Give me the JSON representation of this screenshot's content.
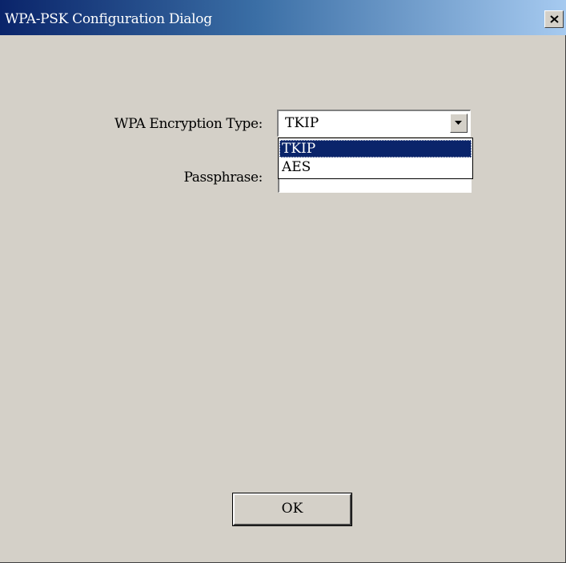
{
  "window": {
    "title": "WPA-PSK Configuration Dialog",
    "close_icon": "close-icon"
  },
  "form": {
    "encryption_label": "WPA Encryption Type:",
    "encryption_value": "TKIP",
    "encryption_options": [
      "TKIP",
      "AES"
    ],
    "selected_option": "TKIP",
    "passphrase_label": "Passphrase:",
    "passphrase_value": ""
  },
  "buttons": {
    "ok_label": "OK"
  },
  "colors": {
    "titlebar_start": "#0a246a",
    "titlebar_end": "#a6caf0",
    "dialog_bg": "#d4d0c8",
    "selection": "#0a246a"
  }
}
